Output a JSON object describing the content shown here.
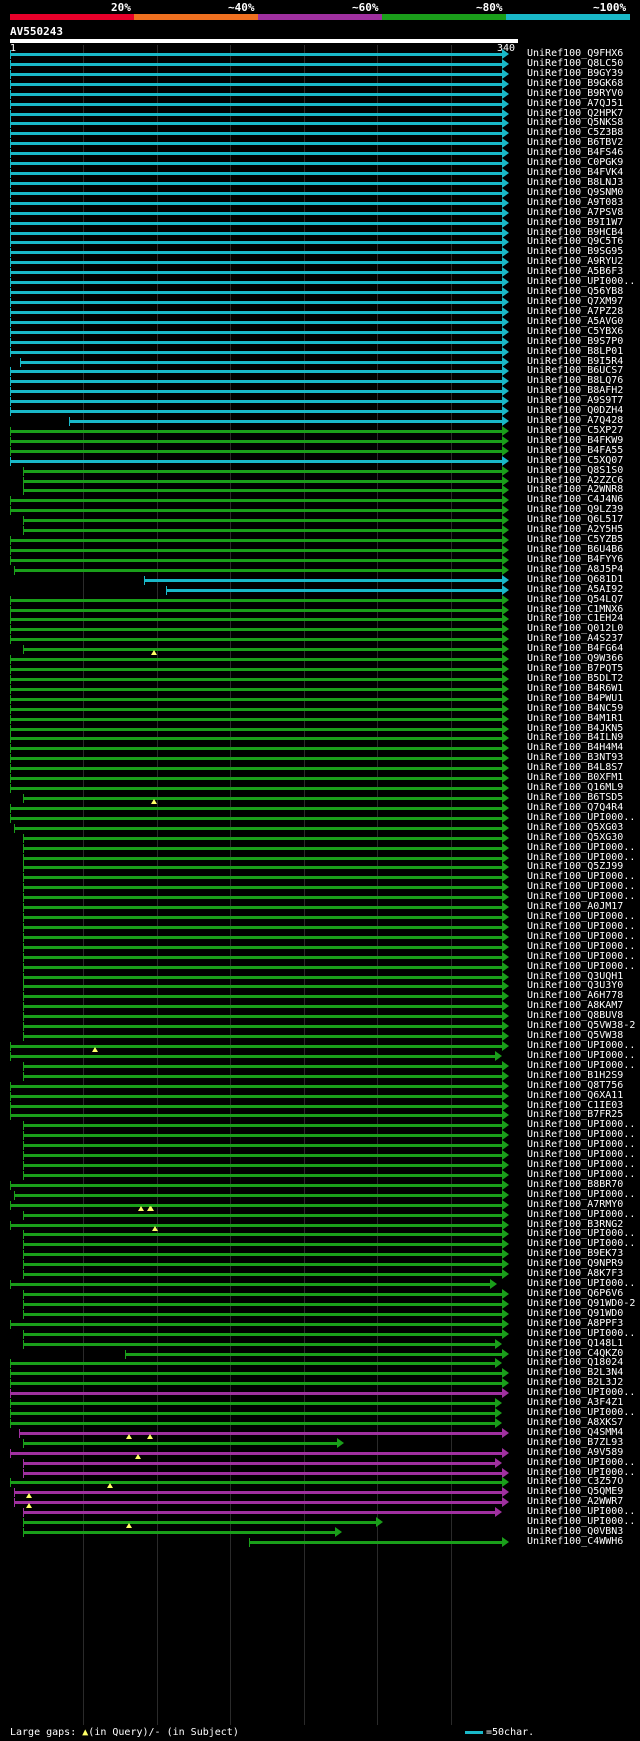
{
  "legend": {
    "labels": [
      "20%",
      "~40%",
      "~60%",
      "~80%",
      "~100%"
    ],
    "colors": [
      "#e8002a",
      "#f07020",
      "#a030a0",
      "#1a9e1a",
      "#19b8c8"
    ]
  },
  "query": {
    "name": "AV550243",
    "start": "1",
    "end": "340",
    "length": 340
  },
  "footer": {
    "large_gaps": "Large gaps:",
    "in_query": "(in Query)/",
    "dash": "-",
    "in_subject": "(in Subject)",
    "scale_label": "=50char.",
    "scale_color": "#19b8c8"
  },
  "hits": [
    {
      "name": "UniRef100_Q9FHX6",
      "s": 1,
      "e": 340,
      "c": "cyan"
    },
    {
      "name": "UniRef100_Q8LC50",
      "s": 1,
      "e": 340,
      "c": "cyan"
    },
    {
      "name": "UniRef100_B9GY39",
      "s": 1,
      "e": 340,
      "c": "cyan"
    },
    {
      "name": "UniRef100_B9GK68",
      "s": 1,
      "e": 340,
      "c": "cyan"
    },
    {
      "name": "UniRef100_B9RYV0",
      "s": 1,
      "e": 340,
      "c": "cyan"
    },
    {
      "name": "UniRef100_A7QJ51",
      "s": 1,
      "e": 340,
      "c": "cyan"
    },
    {
      "name": "UniRef100_Q2HPK7",
      "s": 1,
      "e": 340,
      "c": "cyan"
    },
    {
      "name": "UniRef100_Q5NKS8",
      "s": 1,
      "e": 340,
      "c": "cyan"
    },
    {
      "name": "UniRef100_C5Z3B8",
      "s": 1,
      "e": 340,
      "c": "cyan"
    },
    {
      "name": "UniRef100_B6TBV2",
      "s": 1,
      "e": 340,
      "c": "cyan"
    },
    {
      "name": "UniRef100_B4FS46",
      "s": 1,
      "e": 340,
      "c": "cyan"
    },
    {
      "name": "UniRef100_C0PGK9",
      "s": 1,
      "e": 340,
      "c": "cyan"
    },
    {
      "name": "UniRef100_B4FVK4",
      "s": 1,
      "e": 340,
      "c": "cyan"
    },
    {
      "name": "UniRef100_B8LNJ3",
      "s": 1,
      "e": 340,
      "c": "cyan"
    },
    {
      "name": "UniRef100_Q9SNM0",
      "s": 1,
      "e": 340,
      "c": "cyan"
    },
    {
      "name": "UniRef100_A9T083",
      "s": 1,
      "e": 340,
      "c": "cyan"
    },
    {
      "name": "UniRef100_A7PSV8",
      "s": 1,
      "e": 340,
      "c": "cyan"
    },
    {
      "name": "UniRef100_B9I1W7",
      "s": 1,
      "e": 340,
      "c": "cyan"
    },
    {
      "name": "UniRef100_B9HCB4",
      "s": 1,
      "e": 340,
      "c": "cyan"
    },
    {
      "name": "UniRef100_Q9C5T6",
      "s": 1,
      "e": 340,
      "c": "cyan"
    },
    {
      "name": "UniRef100_B9SG95",
      "s": 1,
      "e": 340,
      "c": "cyan"
    },
    {
      "name": "UniRef100_A9RYU2",
      "s": 1,
      "e": 340,
      "c": "cyan"
    },
    {
      "name": "UniRef100_A5B6F3",
      "s": 1,
      "e": 340,
      "c": "cyan"
    },
    {
      "name": "UniRef100_UPI000..",
      "s": 1,
      "e": 340,
      "c": "cyan"
    },
    {
      "name": "UniRef100_Q56YB8",
      "s": 1,
      "e": 340,
      "c": "cyan"
    },
    {
      "name": "UniRef100_Q7XM97",
      "s": 1,
      "e": 340,
      "c": "cyan"
    },
    {
      "name": "UniRef100_A7PZ28",
      "s": 1,
      "e": 340,
      "c": "cyan"
    },
    {
      "name": "UniRef100_A5AVG0",
      "s": 1,
      "e": 340,
      "c": "cyan"
    },
    {
      "name": "UniRef100_C5YBX6",
      "s": 1,
      "e": 340,
      "c": "cyan"
    },
    {
      "name": "UniRef100_B9S7P0",
      "s": 1,
      "e": 340,
      "c": "cyan"
    },
    {
      "name": "UniRef100_B8LP01",
      "s": 1,
      "e": 340,
      "c": "cyan"
    },
    {
      "name": "UniRef100_B9I5R4",
      "s": 8,
      "e": 340,
      "c": "cyan"
    },
    {
      "name": "UniRef100_B6UCS7",
      "s": 1,
      "e": 340,
      "c": "cyan"
    },
    {
      "name": "UniRef100_B8LQ76",
      "s": 1,
      "e": 340,
      "c": "cyan"
    },
    {
      "name": "UniRef100_B8AFH2",
      "s": 1,
      "e": 340,
      "c": "cyan"
    },
    {
      "name": "UniRef100_A9S9T7",
      "s": 1,
      "e": 340,
      "c": "cyan"
    },
    {
      "name": "UniRef100_Q0DZH4",
      "s": 1,
      "e": 340,
      "c": "cyan"
    },
    {
      "name": "UniRef100_A7Q428",
      "s": 41,
      "e": 340,
      "c": "cyan"
    },
    {
      "name": "UniRef100_C5XP27",
      "s": 1,
      "e": 340,
      "c": "green"
    },
    {
      "name": "UniRef100_B4FKW9",
      "s": 1,
      "e": 340,
      "c": "green"
    },
    {
      "name": "UniRef100_B4FA55",
      "s": 1,
      "e": 340,
      "c": "green"
    },
    {
      "name": "UniRef100_C5XQ07",
      "s": 1,
      "e": 340,
      "c": "cyan"
    },
    {
      "name": "UniRef100_Q8S1S0",
      "s": 10,
      "e": 340,
      "c": "green"
    },
    {
      "name": "UniRef100_A2ZZC6",
      "s": 10,
      "e": 340,
      "c": "green"
    },
    {
      "name": "UniRef100_A2WNR8",
      "s": 10,
      "e": 340,
      "c": "green"
    },
    {
      "name": "UniRef100_C4J4N6",
      "s": 1,
      "e": 340,
      "c": "green"
    },
    {
      "name": "UniRef100_Q9LZ39",
      "s": 1,
      "e": 340,
      "c": "green"
    },
    {
      "name": "UniRef100_Q6L517",
      "s": 10,
      "e": 340,
      "c": "green"
    },
    {
      "name": "UniRef100_A2Y5H5",
      "s": 10,
      "e": 340,
      "c": "green"
    },
    {
      "name": "UniRef100_C5YZB5",
      "s": 1,
      "e": 340,
      "c": "green"
    },
    {
      "name": "UniRef100_B6U4B6",
      "s": 1,
      "e": 340,
      "c": "green"
    },
    {
      "name": "UniRef100_B4FYY6",
      "s": 1,
      "e": 340,
      "c": "green"
    },
    {
      "name": "UniRef100_A8J5P4",
      "s": 4,
      "e": 340,
      "c": "green"
    },
    {
      "name": "UniRef100_Q681D1",
      "s": 92,
      "e": 340,
      "c": "cyan"
    },
    {
      "name": "UniRef100_A5AI92",
      "s": 107,
      "e": 340,
      "c": "cyan"
    },
    {
      "name": "UniRef100_Q54LQ7",
      "s": 1,
      "e": 340,
      "c": "green"
    },
    {
      "name": "UniRef100_C1MNX6",
      "s": 1,
      "e": 340,
      "c": "green"
    },
    {
      "name": "UniRef100_C1EH24",
      "s": 1,
      "e": 340,
      "c": "green"
    },
    {
      "name": "UniRef100_Q012L0",
      "s": 1,
      "e": 340,
      "c": "green"
    },
    {
      "name": "UniRef100_A4S237",
      "s": 1,
      "e": 340,
      "c": "green"
    },
    {
      "name": "UniRef100_B4FG64",
      "s": 10,
      "e": 340,
      "c": "green",
      "gaps": [
        99
      ]
    },
    {
      "name": "UniRef100_Q9W366",
      "s": 1,
      "e": 340,
      "c": "green"
    },
    {
      "name": "UniRef100_B7PQT5",
      "s": 1,
      "e": 340,
      "c": "green"
    },
    {
      "name": "UniRef100_B5DLT2",
      "s": 1,
      "e": 340,
      "c": "green"
    },
    {
      "name": "UniRef100_B4R6W1",
      "s": 1,
      "e": 340,
      "c": "green"
    },
    {
      "name": "UniRef100_B4PWU1",
      "s": 1,
      "e": 340,
      "c": "green"
    },
    {
      "name": "UniRef100_B4NC59",
      "s": 1,
      "e": 340,
      "c": "green"
    },
    {
      "name": "UniRef100_B4M1R1",
      "s": 1,
      "e": 340,
      "c": "green"
    },
    {
      "name": "UniRef100_B4JKN5",
      "s": 1,
      "e": 340,
      "c": "green"
    },
    {
      "name": "UniRef100_B4ILN9",
      "s": 1,
      "e": 340,
      "c": "green"
    },
    {
      "name": "UniRef100_B4H4M4",
      "s": 1,
      "e": 340,
      "c": "green"
    },
    {
      "name": "UniRef100_B3NT93",
      "s": 1,
      "e": 340,
      "c": "green"
    },
    {
      "name": "UniRef100_B4L8S7",
      "s": 1,
      "e": 340,
      "c": "green"
    },
    {
      "name": "UniRef100_B0XFM1",
      "s": 1,
      "e": 340,
      "c": "green"
    },
    {
      "name": "UniRef100_Q16ML9",
      "s": 1,
      "e": 340,
      "c": "green"
    },
    {
      "name": "UniRef100_B6TSD5",
      "s": 10,
      "e": 340,
      "c": "green",
      "gaps": [
        99
      ]
    },
    {
      "name": "UniRef100_Q7Q4R4",
      "s": 1,
      "e": 340,
      "c": "green"
    },
    {
      "name": "UniRef100_UPI000..",
      "s": 1,
      "e": 340,
      "c": "green"
    },
    {
      "name": "UniRef100_Q5XG03",
      "s": 4,
      "e": 340,
      "c": "green"
    },
    {
      "name": "UniRef100_Q5XG30",
      "s": 10,
      "e": 340,
      "c": "green"
    },
    {
      "name": "UniRef100_UPI000..",
      "s": 10,
      "e": 340,
      "c": "green"
    },
    {
      "name": "UniRef100_UPI000..",
      "s": 10,
      "e": 340,
      "c": "green"
    },
    {
      "name": "UniRef100_Q5ZJ99",
      "s": 10,
      "e": 340,
      "c": "green"
    },
    {
      "name": "UniRef100_UPI000..",
      "s": 10,
      "e": 340,
      "c": "green"
    },
    {
      "name": "UniRef100_UPI000..",
      "s": 10,
      "e": 340,
      "c": "green"
    },
    {
      "name": "UniRef100_UPI000..",
      "s": 10,
      "e": 340,
      "c": "green"
    },
    {
      "name": "UniRef100_A0JM17",
      "s": 10,
      "e": 340,
      "c": "green"
    },
    {
      "name": "UniRef100_UPI000..",
      "s": 10,
      "e": 340,
      "c": "green"
    },
    {
      "name": "UniRef100_UPI000..",
      "s": 10,
      "e": 340,
      "c": "green"
    },
    {
      "name": "UniRef100_UPI000..",
      "s": 10,
      "e": 340,
      "c": "green"
    },
    {
      "name": "UniRef100_UPI000..",
      "s": 10,
      "e": 340,
      "c": "green"
    },
    {
      "name": "UniRef100_UPI000..",
      "s": 10,
      "e": 340,
      "c": "green"
    },
    {
      "name": "UniRef100_UPI000..",
      "s": 10,
      "e": 340,
      "c": "green"
    },
    {
      "name": "UniRef100_Q3UQH1",
      "s": 10,
      "e": 340,
      "c": "green"
    },
    {
      "name": "UniRef100_Q3U3Y0",
      "s": 10,
      "e": 340,
      "c": "green"
    },
    {
      "name": "UniRef100_A6H778",
      "s": 10,
      "e": 340,
      "c": "green"
    },
    {
      "name": "UniRef100_A8KAM7",
      "s": 10,
      "e": 340,
      "c": "green"
    },
    {
      "name": "UniRef100_Q8BUV8",
      "s": 10,
      "e": 340,
      "c": "green"
    },
    {
      "name": "UniRef100_Q5VW38-2",
      "s": 10,
      "e": 340,
      "c": "green"
    },
    {
      "name": "UniRef100_Q5VW38",
      "s": 10,
      "e": 340,
      "c": "green"
    },
    {
      "name": "UniRef100_UPI000..",
      "s": 1,
      "e": 340,
      "c": "green",
      "gaps": [
        59
      ]
    },
    {
      "name": "UniRef100_UPI000..",
      "s": 1,
      "e": 335,
      "c": "green"
    },
    {
      "name": "UniRef100_UPI000..",
      "s": 10,
      "e": 340,
      "c": "green"
    },
    {
      "name": "UniRef100_B1H2S9",
      "s": 10,
      "e": 340,
      "c": "green"
    },
    {
      "name": "UniRef100_Q8T756",
      "s": 1,
      "e": 340,
      "c": "green"
    },
    {
      "name": "UniRef100_Q6XA11",
      "s": 1,
      "e": 340,
      "c": "green"
    },
    {
      "name": "UniRef100_C1IE03",
      "s": 1,
      "e": 340,
      "c": "green"
    },
    {
      "name": "UniRef100_B7FR25",
      "s": 1,
      "e": 340,
      "c": "green"
    },
    {
      "name": "UniRef100_UPI000..",
      "s": 10,
      "e": 340,
      "c": "green"
    },
    {
      "name": "UniRef100_UPI000..",
      "s": 10,
      "e": 340,
      "c": "green"
    },
    {
      "name": "UniRef100_UPI000..",
      "s": 10,
      "e": 340,
      "c": "green"
    },
    {
      "name": "UniRef100_UPI000..",
      "s": 10,
      "e": 340,
      "c": "green"
    },
    {
      "name": "UniRef100_UPI000..",
      "s": 10,
      "e": 340,
      "c": "green"
    },
    {
      "name": "UniRef100_UPI000..",
      "s": 10,
      "e": 340,
      "c": "green"
    },
    {
      "name": "UniRef100_B8BR70",
      "s": 1,
      "e": 340,
      "c": "green"
    },
    {
      "name": "UniRef100_UPI000..",
      "s": 4,
      "e": 340,
      "c": "green"
    },
    {
      "name": "UniRef100_A7RMY0",
      "s": 1,
      "e": 340,
      "c": "green",
      "gaps": [
        90,
        96,
        97
      ]
    },
    {
      "name": "UniRef100_UPI000..",
      "s": 10,
      "e": 340,
      "c": "green"
    },
    {
      "name": "UniRef100_B3RNG2",
      "s": 1,
      "e": 340,
      "c": "green",
      "gaps": [
        100
      ]
    },
    {
      "name": "UniRef100_UPI000..",
      "s": 10,
      "e": 340,
      "c": "green"
    },
    {
      "name": "UniRef100_UPI000..",
      "s": 10,
      "e": 340,
      "c": "green"
    },
    {
      "name": "UniRef100_B9EK73",
      "s": 10,
      "e": 340,
      "c": "green"
    },
    {
      "name": "UniRef100_Q9NPR9",
      "s": 10,
      "e": 340,
      "c": "green"
    },
    {
      "name": "UniRef100_A8K7F3",
      "s": 10,
      "e": 340,
      "c": "green"
    },
    {
      "name": "UniRef100_UPI000..",
      "s": 1,
      "e": 332,
      "c": "green"
    },
    {
      "name": "UniRef100_Q6P6V6",
      "s": 10,
      "e": 340,
      "c": "green"
    },
    {
      "name": "UniRef100_Q91WD0-2",
      "s": 10,
      "e": 340,
      "c": "green"
    },
    {
      "name": "UniRef100_Q91WD0",
      "s": 10,
      "e": 340,
      "c": "green"
    },
    {
      "name": "UniRef100_A8PPF3",
      "s": 1,
      "e": 340,
      "c": "green"
    },
    {
      "name": "UniRef100_UPI000..",
      "s": 10,
      "e": 340,
      "c": "green"
    },
    {
      "name": "UniRef100_Q148L1",
      "s": 10,
      "e": 335,
      "c": "green"
    },
    {
      "name": "UniRef100_C4QKZ0",
      "s": 79,
      "e": 340,
      "c": "green"
    },
    {
      "name": "UniRef100_Q18024",
      "s": 1,
      "e": 335,
      "c": "green"
    },
    {
      "name": "UniRef100_B2L3N4",
      "s": 1,
      "e": 340,
      "c": "green"
    },
    {
      "name": "UniRef100_B2L3J2",
      "s": 1,
      "e": 340,
      "c": "green"
    },
    {
      "name": "UniRef100_UPI000..",
      "s": 1,
      "e": 340,
      "c": "purple"
    },
    {
      "name": "UniRef100_A3F4Z1",
      "s": 1,
      "e": 335,
      "c": "green"
    },
    {
      "name": "UniRef100_UPI000..",
      "s": 1,
      "e": 335,
      "c": "green"
    },
    {
      "name": "UniRef100_A8XKS7",
      "s": 1,
      "e": 335,
      "c": "green"
    },
    {
      "name": "UniRef100_Q4SMM4",
      "s": 7,
      "e": 340,
      "c": "purple",
      "gaps": [
        82,
        96
      ]
    },
    {
      "name": "UniRef100_B7ZL93",
      "s": 10,
      "e": 228,
      "c": "green"
    },
    {
      "name": "UniRef100_A9V589",
      "s": 1,
      "e": 340,
      "c": "purple",
      "gaps": [
        88
      ]
    },
    {
      "name": "UniRef100_UPI000..",
      "s": 10,
      "e": 335,
      "c": "purple"
    },
    {
      "name": "UniRef100_UPI000..",
      "s": 10,
      "e": 340,
      "c": "purple"
    },
    {
      "name": "UniRef100_C3Z57O",
      "s": 1,
      "e": 340,
      "c": "green",
      "gaps": [
        69
      ]
    },
    {
      "name": "UniRef100_Q5QME9",
      "s": 4,
      "e": 340,
      "c": "purple",
      "gaps": [
        14
      ]
    },
    {
      "name": "UniRef100_A2WWR7",
      "s": 4,
      "e": 340,
      "c": "purple",
      "gaps": [
        14
      ]
    },
    {
      "name": "UniRef100_UPI000..",
      "s": 10,
      "e": 335,
      "c": "purple"
    },
    {
      "name": "UniRef100_UPI000..",
      "s": 10,
      "e": 254,
      "c": "green",
      "gaps": [
        82
      ]
    },
    {
      "name": "UniRef100_Q0VBN3",
      "s": 10,
      "e": 226,
      "c": "green"
    },
    {
      "name": "UniRef100_C4WWH6",
      "s": 164,
      "e": 340,
      "c": "green"
    }
  ]
}
